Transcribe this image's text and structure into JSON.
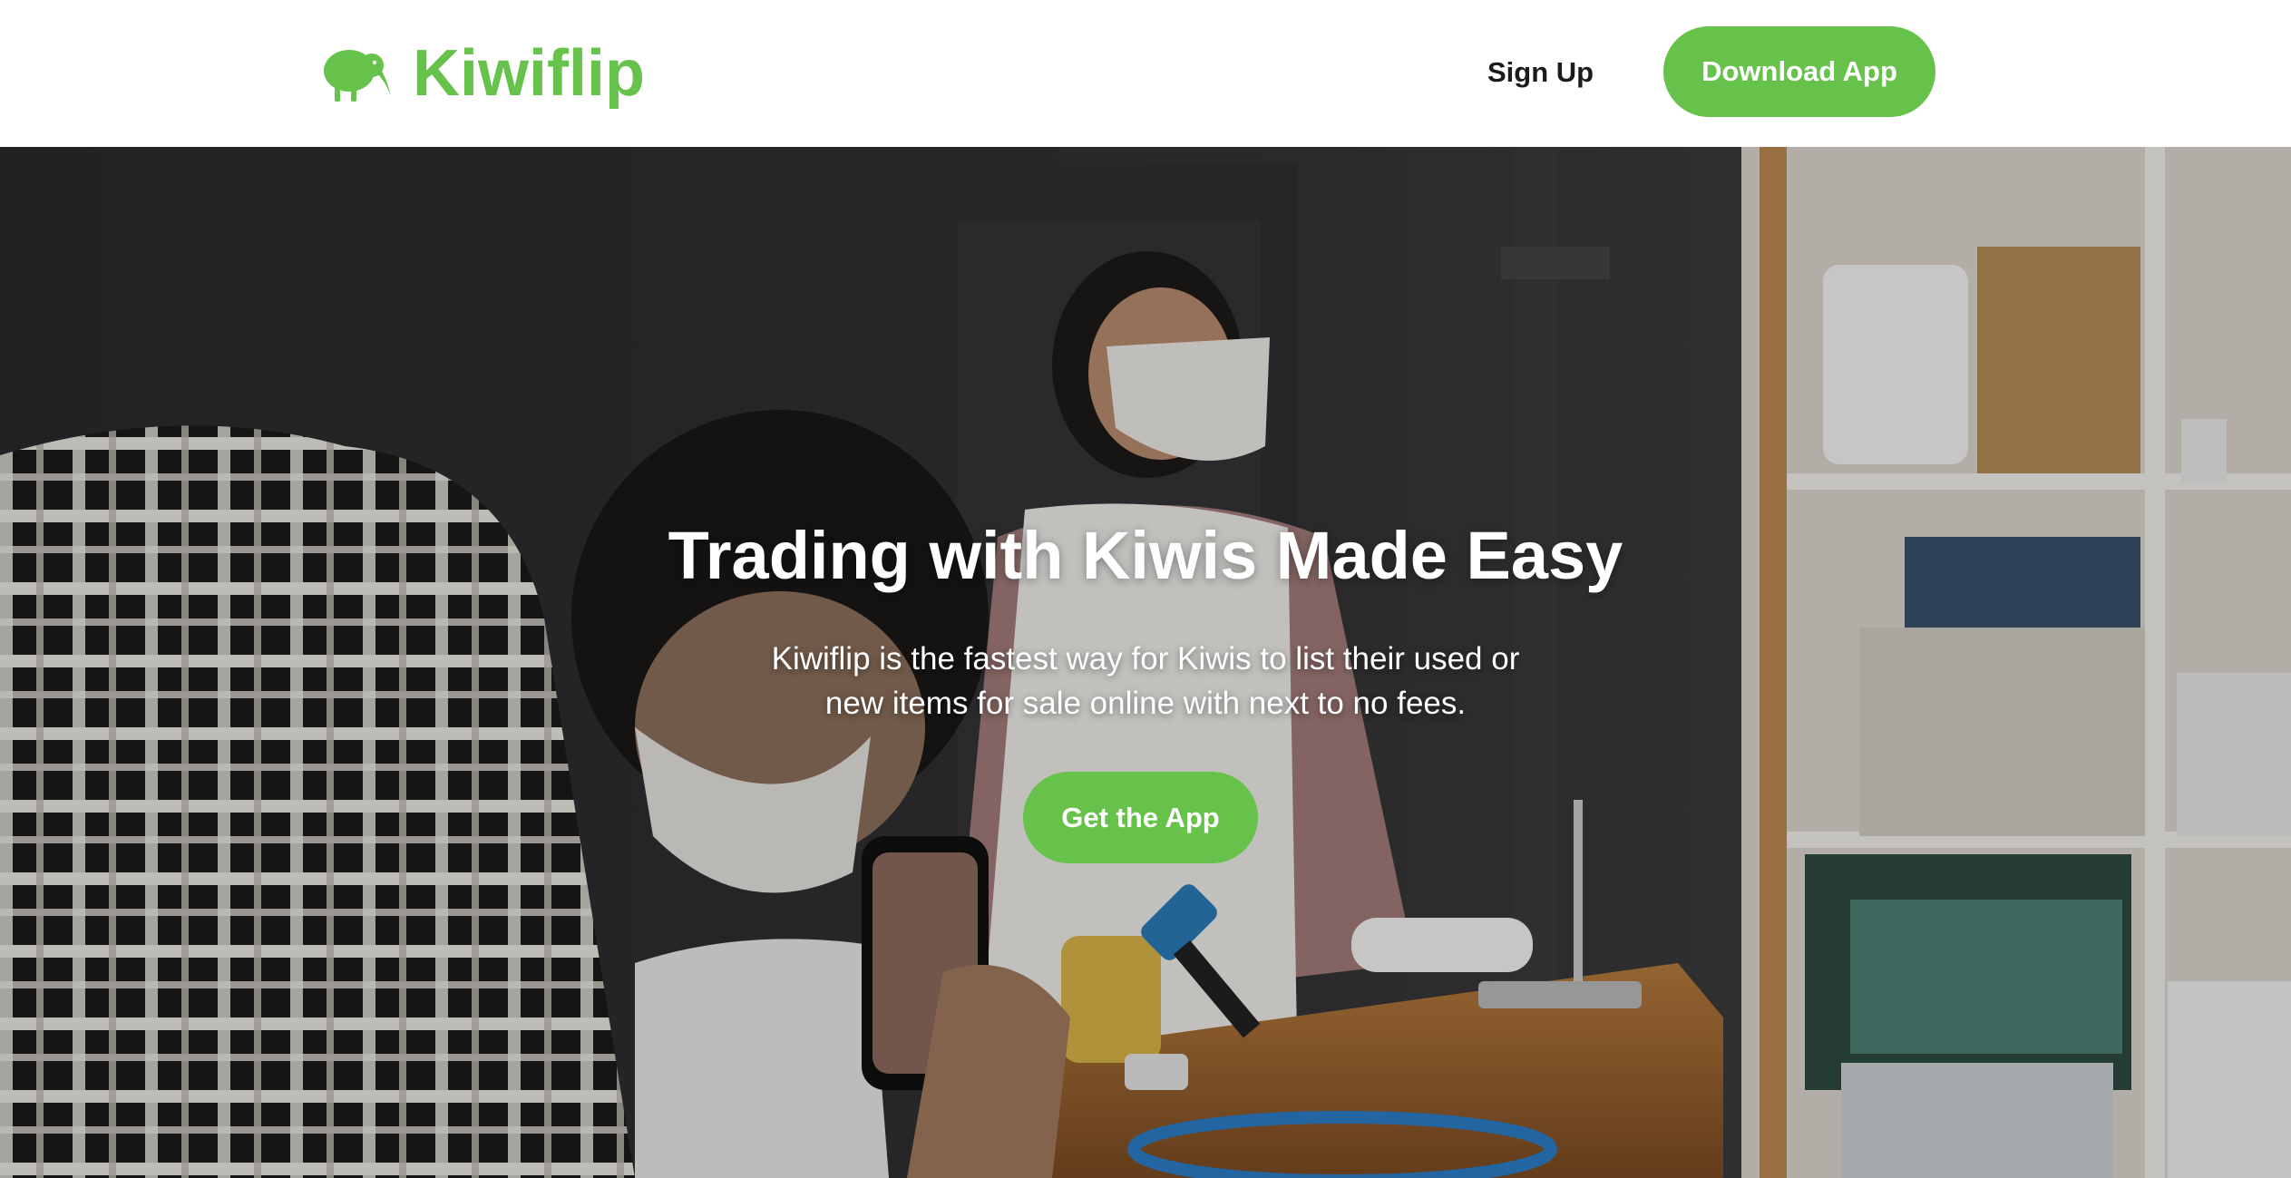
{
  "nav": {
    "brand": "Kiwiflip",
    "signup_label": "Sign Up",
    "download_label": "Download App"
  },
  "hero": {
    "title": "Trading with Kiwis Made Easy",
    "subtitle_line1": "Kiwiflip is the fastest way for Kiwis to list their used or",
    "subtitle_line2": "new items for sale online with next to no fees.",
    "cta_label": "Get the App"
  },
  "colors": {
    "brand_green": "#66c24a",
    "text_dark": "#1b1b1b",
    "white": "#ffffff"
  },
  "icons": {
    "logo": "kiwi-bird-icon"
  }
}
